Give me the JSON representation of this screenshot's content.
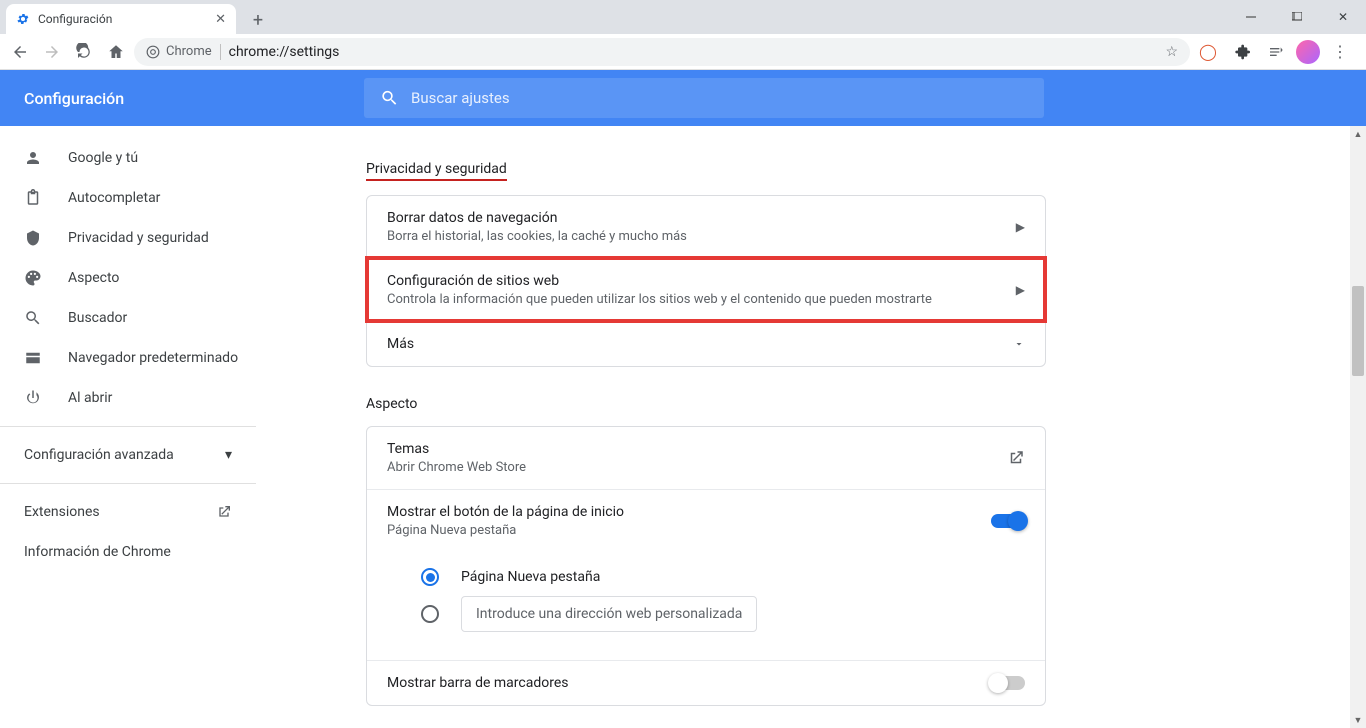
{
  "window": {
    "tab_title": "Configuración"
  },
  "toolbar": {
    "secure_label": "Chrome",
    "url": "chrome://settings"
  },
  "header": {
    "title": "Configuración",
    "search_placeholder": "Buscar ajustes"
  },
  "sidebar": {
    "items": [
      {
        "icon": "person",
        "label": "Google y tú"
      },
      {
        "icon": "clipboard",
        "label": "Autocompletar"
      },
      {
        "icon": "shield",
        "label": "Privacidad y seguridad"
      },
      {
        "icon": "palette",
        "label": "Aspecto"
      },
      {
        "icon": "search",
        "label": "Buscador"
      },
      {
        "icon": "browser",
        "label": "Navegador predeterminado"
      },
      {
        "icon": "power",
        "label": "Al abrir"
      }
    ],
    "advanced": "Configuración avanzada",
    "extensions": "Extensiones",
    "about": "Información de Chrome"
  },
  "main": {
    "privacy": {
      "title": "Privacidad y seguridad",
      "rows": [
        {
          "title": "Borrar datos de navegación",
          "desc": "Borra el historial, las cookies, la caché y mucho más",
          "arrow": "▶"
        },
        {
          "title": "Configuración de sitios web",
          "desc": "Controla la información que pueden utilizar los sitios web y el contenido que pueden mostrarte",
          "arrow": "▶",
          "highlight": true
        },
        {
          "title": "Más",
          "desc": "",
          "arrow": "▾"
        }
      ]
    },
    "appearance": {
      "title": "Aspecto",
      "themes": {
        "title": "Temas",
        "desc": "Abrir Chrome Web Store"
      },
      "home_button": {
        "title": "Mostrar el botón de la página de inicio",
        "desc": "Página Nueva pestaña"
      },
      "radio_newtab": "Página Nueva pestaña",
      "custom_url_placeholder": "Introduce una dirección web personalizada",
      "bookmarks_bar": {
        "title": "Mostrar barra de marcadores"
      }
    }
  }
}
